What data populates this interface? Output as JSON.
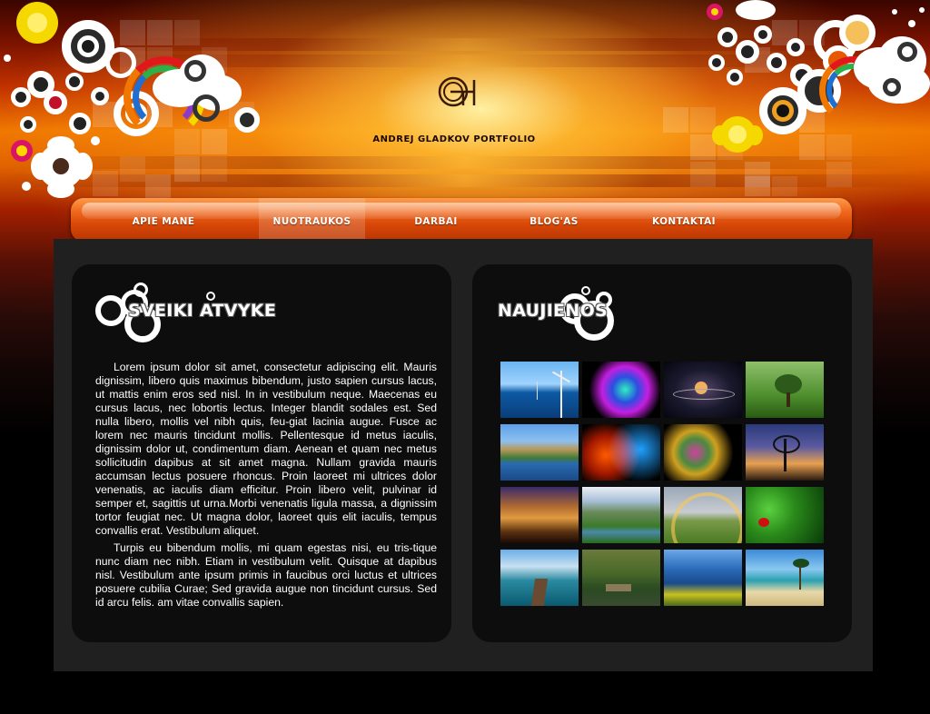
{
  "site": {
    "logo_icon": "ag-monogram-logo",
    "tagline": "ANDREJ GLADKOV PORTFOLIO"
  },
  "nav": {
    "items": [
      {
        "label": "APIE MANE"
      },
      {
        "label": "NUOTRAUKOS",
        "active": true
      },
      {
        "label": "DARBAI"
      },
      {
        "label": "BLOG'AS"
      },
      {
        "label": "KONTAKTAI"
      }
    ]
  },
  "welcome": {
    "title": "SVEIKI ATVYKE",
    "paragraphs": [
      "Lorem ipsum dolor sit amet, consectetur adipiscing elit. Mauris dignissim, libero quis maximus bibendum, justo sapien cursus lacus, ut mattis enim eros sed nisl. In in vestibulum neque. Maecenas eu cursus lacus, nec lobortis lectus. Integer blandit sodales est. Sed nulla libero, mollis vel nibh quis, feu-giat lacinia augue. Fusce ac lorem nec mauris tincidunt mollis. Pellentesque id metus iaculis, dignissim dolor ut, condimentum diam. Aenean et quam nec metus sollicitudin dapibus at sit amet magna. Nullam gravida mauris accumsan lectus posuere rhoncus. Proin laoreet mi ultrices dolor venenatis, ac iaculis diam efficitur. Proin libero velit, pulvinar id semper et, sagittis ut urna.Morbi venenatis ligula massa, a dignissim tortor feugiat nec. Ut magna dolor, laoreet quis elit iaculis, tempus convallis erat. Vestibulum aliquet.",
      "Turpis eu bibendum mollis, mi quam egestas nisi, eu tris-tique nunc diam nec nibh. Etiam in vestibulum velit. Quisque at dapibus nisl. Vestibulum ante ipsum primis in faucibus orci luctus et ultrices posuere cubilia Curae; Sed gravida augue non tincidunt cursus. Sed id arcu felis. am vitae convallis sapien."
    ]
  },
  "news": {
    "title": "NAUJIENOS",
    "thumbnails": [
      {
        "name": "wind-turbines-sea-thumb"
      },
      {
        "name": "neon-swirl-thumb"
      },
      {
        "name": "planets-orbit-thumb"
      },
      {
        "name": "green-tree-thumb"
      },
      {
        "name": "cliff-village-lake-thumb"
      },
      {
        "name": "fire-ice-smoke-thumb"
      },
      {
        "name": "colored-smoke-thumb"
      },
      {
        "name": "bare-tree-sunset-thumb"
      },
      {
        "name": "city-lights-thumb"
      },
      {
        "name": "mountain-river-thumb"
      },
      {
        "name": "rainbow-field-thumb"
      },
      {
        "name": "ladybug-leaves-thumb"
      },
      {
        "name": "pier-lake-thumb"
      },
      {
        "name": "boat-forest-thumb"
      },
      {
        "name": "rocky-coast-flowers-thumb"
      },
      {
        "name": "palm-beach-thumb"
      }
    ]
  },
  "colors": {
    "nav_orange": "#e05a10",
    "panel": "#0d0d0d",
    "content_bg": "#202020"
  }
}
